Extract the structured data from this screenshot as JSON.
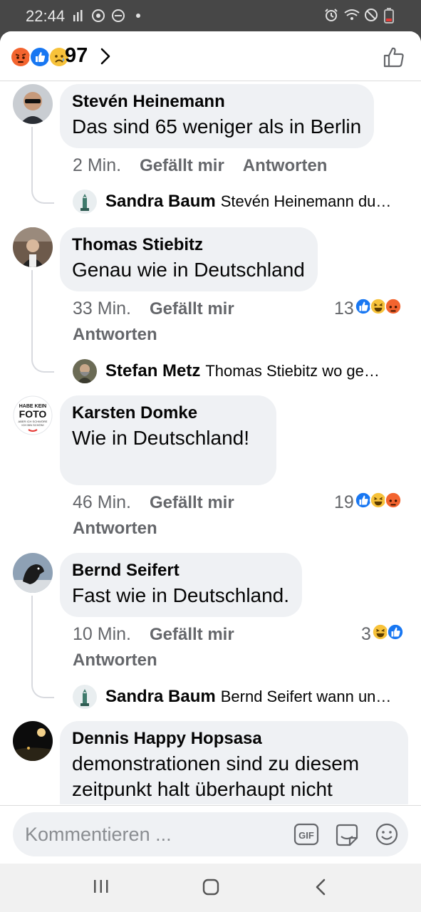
{
  "status_bar": {
    "time": "22:44",
    "left_icons": [
      "signal-bars-icon",
      "whatsapp-icon",
      "do-not-disturb-icon",
      "dot-icon"
    ],
    "right_icons": [
      "alarm-icon",
      "wifi-icon",
      "no-sim-icon",
      "battery-low-icon"
    ]
  },
  "header": {
    "reactions": [
      "angry-reaction-icon",
      "like-reaction-icon",
      "sad-reaction-icon"
    ],
    "reaction_count": "97",
    "chevron": "chevron-right-icon",
    "like_button_icon": "thumbs-up-icon"
  },
  "comments": [
    {
      "author": "Stevén Heinemann",
      "text": "Das sind 65 weniger als in Berlin",
      "time": "2 Min.",
      "like_label": "Gefällt mir",
      "reply_label": "Antworten",
      "reply": {
        "name": "Sandra Baum",
        "text": "Stevén Heinemann du…"
      }
    },
    {
      "author": "Thomas Stiebitz",
      "text": "Genau wie in Deutschland",
      "time": "33 Min.",
      "like_label": "Gefällt mir",
      "reply_label": "Antworten",
      "reaction_count": "13",
      "reply": {
        "name": "Stefan Metz",
        "text": "Thomas Stiebitz  wo ge…"
      }
    },
    {
      "author": "Karsten Domke",
      "text": "Wie in Deutschland!",
      "time": "46 Min.",
      "like_label": "Gefällt mir",
      "reply_label": "Antworten",
      "reaction_count": "19",
      "avatar_text": [
        "HABE KEIN",
        "FOTO",
        "ABER ICH SCHWÖRE",
        "ICH BIN SCHÖN!"
      ]
    },
    {
      "author": "Bernd Seifert",
      "text": "Fast wie in Deutschland.",
      "time": "10 Min.",
      "like_label": "Gefällt mir",
      "reply_label": "Antworten",
      "reaction_count": "3",
      "reply": {
        "name": "Sandra Baum",
        "text": "Bernd Seifert wann un…"
      }
    },
    {
      "author": "Dennis Happy Hopsasa",
      "text": "demonstrationen sind zu diesem zeitpunkt halt überhaupt nicht"
    }
  ],
  "composer": {
    "placeholder": "Kommentieren ...",
    "icons": [
      "gif-icon",
      "sticker-icon",
      "emoji-icon"
    ]
  },
  "nav_bar": {
    "icons": [
      "recent-apps-icon",
      "home-icon",
      "back-icon"
    ]
  },
  "colors": {
    "like_blue": "#1877f2",
    "bubble_bg": "#eff1f4",
    "meta_gray": "#65676b",
    "status_bar_bg": "#474747"
  }
}
